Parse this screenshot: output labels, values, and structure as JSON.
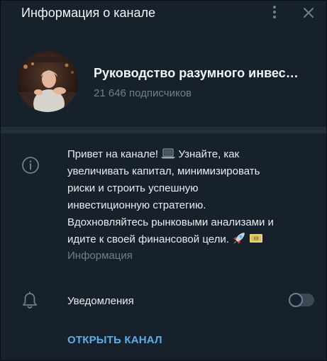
{
  "header": {
    "title": "Информация о канале",
    "menu_icon": "more-vertical-icon",
    "close_icon": "close-icon"
  },
  "channel": {
    "name": "Руководство разумного инвес…",
    "subscribers": "21 646 подписчиков",
    "avatar_icon": "channel-avatar-photo"
  },
  "description": {
    "lines": [
      "Привет на канале!",
      "Узнайте, как",
      "увеличивать капитал, минимизировать",
      "риски и строить успешную",
      "инвестиционную стратегию.",
      "Вдохновляйтесь рынковыми анализами и",
      "идите к своей финансовой цели."
    ],
    "emojis": [
      "laptop-emoji",
      "rocket-emoji",
      "money-emoji"
    ],
    "label": "Информация"
  },
  "notifications": {
    "label": "Уведомления",
    "enabled": false
  },
  "actions": {
    "open_channel": "ОТКРЫТЬ КАНАЛ"
  },
  "colors": {
    "background": "#17212b",
    "divider": "#232e3c",
    "text": "#e9edf1",
    "muted": "#6d7f8f",
    "accent": "#5dade9"
  }
}
